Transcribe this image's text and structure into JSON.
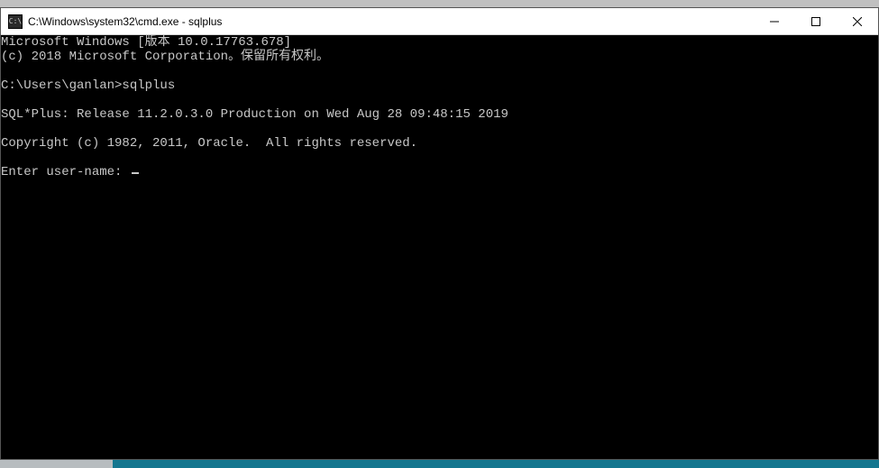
{
  "window": {
    "title": "C:\\Windows\\system32\\cmd.exe - sqlplus"
  },
  "terminal": {
    "lines": [
      "Microsoft Windows [版本 10.0.17763.678]",
      "(c) 2018 Microsoft Corporation。保留所有权利。",
      "",
      "C:\\Users\\ganlan>sqlplus",
      "",
      "SQL*Plus: Release 11.2.0.3.0 Production on Wed Aug 28 09:48:15 2019",
      "",
      "Copyright (c) 1982, 2011, Oracle.  All rights reserved.",
      "",
      "Enter user-name: "
    ]
  }
}
